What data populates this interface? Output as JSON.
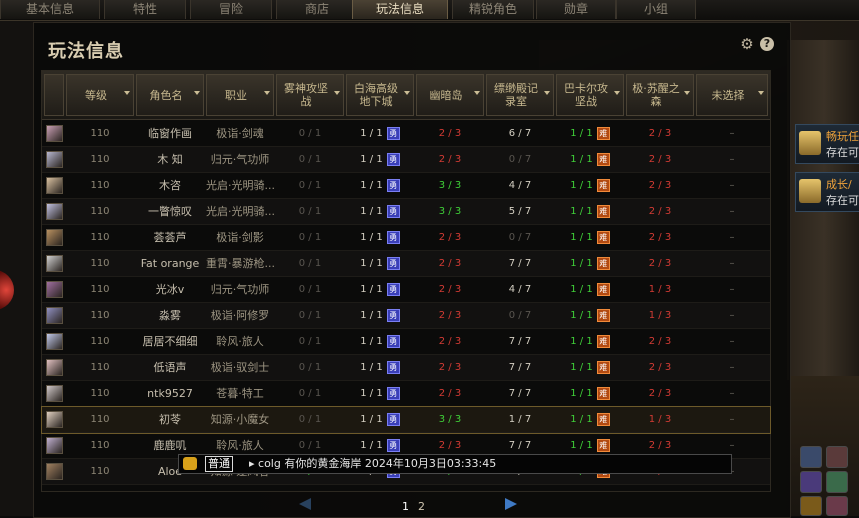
{
  "tabs": [
    {
      "label": "基本信息",
      "active": false
    },
    {
      "label": "特性",
      "active": false
    },
    {
      "label": "冒险",
      "active": false
    },
    {
      "label": "商店",
      "active": false
    },
    {
      "label": "玩法信息",
      "active": true
    },
    {
      "label": "精锐角色",
      "active": false
    },
    {
      "label": "勋章",
      "active": false
    },
    {
      "label": "小组",
      "active": false
    }
  ],
  "panel": {
    "title": "玩法信息"
  },
  "headers": [
    "等级",
    "角色名",
    "职业",
    "雾神攻坚战",
    "白海高级地下城",
    "幽暗岛",
    "缥缈殿记录室",
    "巴卡尔攻坚战",
    "极·苏醒之森",
    "未选择"
  ],
  "badges": {
    "blue": "勇",
    "orange": "难"
  },
  "rows": [
    {
      "level": "110",
      "name": "临窗作画",
      "job": "极诣·剑魂",
      "c1": "0 / 1",
      "c2": "1 / 1",
      "c3": "2 / 3",
      "c4": "6 / 7",
      "c5": "1 / 1",
      "c6": "2 / 3",
      "c7": "–"
    },
    {
      "level": "110",
      "name": "木  知",
      "job": "归元·气功师",
      "c1": "0 / 1",
      "c2": "1 / 1",
      "c3": "2 / 3",
      "c4": "0 / 7",
      "c5": "1 / 1",
      "c6": "2 / 3",
      "c7": "–"
    },
    {
      "level": "110",
      "name": "木咨",
      "job": "光启·光明骑...",
      "c1": "0 / 1",
      "c2": "1 / 1",
      "c3": "3 / 3",
      "c4": "4 / 7",
      "c5": "1 / 1",
      "c6": "2 / 3",
      "c7": "–"
    },
    {
      "level": "110",
      "name": "一瞥惊叹",
      "job": "光启·光明骑...",
      "c1": "0 / 1",
      "c2": "1 / 1",
      "c3": "3 / 3",
      "c4": "5 / 7",
      "c5": "1 / 1",
      "c6": "2 / 3",
      "c7": "–"
    },
    {
      "level": "110",
      "name": "荟荟芦",
      "job": "极诣·剑影",
      "c1": "0 / 1",
      "c2": "1 / 1",
      "c3": "2 / 3",
      "c4": "0 / 7",
      "c5": "1 / 1",
      "c6": "2 / 3",
      "c7": "–"
    },
    {
      "level": "110",
      "name": "Fat orange",
      "job": "重霄·暴游枪...",
      "c1": "0 / 1",
      "c2": "1 / 1",
      "c3": "2 / 3",
      "c4": "7 / 7",
      "c5": "1 / 1",
      "c6": "2 / 3",
      "c7": "–"
    },
    {
      "level": "110",
      "name": "光冰v",
      "job": "归元·气功师",
      "c1": "0 / 1",
      "c2": "1 / 1",
      "c3": "2 / 3",
      "c4": "4 / 7",
      "c5": "1 / 1",
      "c6": "1 / 3",
      "c7": "–"
    },
    {
      "level": "110",
      "name": "淼雾",
      "job": "极诣·阿修罗",
      "c1": "0 / 1",
      "c2": "1 / 1",
      "c3": "2 / 3",
      "c4": "0 / 7",
      "c5": "1 / 1",
      "c6": "1 / 3",
      "c7": "–"
    },
    {
      "level": "110",
      "name": "居居不细细",
      "job": "聆风·旅人",
      "c1": "0 / 1",
      "c2": "1 / 1",
      "c3": "2 / 3",
      "c4": "7 / 7",
      "c5": "1 / 1",
      "c6": "2 / 3",
      "c7": "–"
    },
    {
      "level": "110",
      "name": "低语声",
      "job": "极诣·驭剑士",
      "c1": "0 / 1",
      "c2": "1 / 1",
      "c3": "2 / 3",
      "c4": "7 / 7",
      "c5": "1 / 1",
      "c6": "2 / 3",
      "c7": "–"
    },
    {
      "level": "110",
      "name": "ntk9527",
      "job": "苍暮·特工",
      "c1": "0 / 1",
      "c2": "1 / 1",
      "c3": "2 / 3",
      "c4": "7 / 7",
      "c5": "1 / 1",
      "c6": "2 / 3",
      "c7": "–"
    },
    {
      "level": "110",
      "name": "初苓",
      "job": "知源·小魔女",
      "c1": "0 / 1",
      "c2": "1 / 1",
      "c3": "3 / 3",
      "c4": "1 / 7",
      "c5": "1 / 1",
      "c6": "1 / 3",
      "c7": "–"
    },
    {
      "level": "110",
      "name": "鹿鹿叽",
      "job": "聆风·旅人",
      "c1": "0 / 1",
      "c2": "1 / 1",
      "c3": "2 / 3",
      "c4": "7 / 7",
      "c5": "1 / 1",
      "c6": "2 / 3",
      "c7": "–"
    },
    {
      "level": "110",
      "name": "Aloe",
      "job": "知源·逐风者",
      "c1": "1 / 1",
      "c2": "1 / 1",
      "c3": "3 / 3",
      "c4": "7 / 7",
      "c5": "1 / 1",
      "c6": "3 / 3",
      "c7": "–"
    }
  ],
  "pager": {
    "pages": [
      "1",
      "2"
    ],
    "current": "1"
  },
  "tooltip": {
    "channel": "普通",
    "message": "▸ colg 有你的黄金海岸 2024年10月3日03:33:45"
  },
  "side_cards": [
    {
      "title": "畅玩任",
      "sub": "存在可"
    },
    {
      "title": "成长/",
      "sub": "存在可"
    }
  ]
}
